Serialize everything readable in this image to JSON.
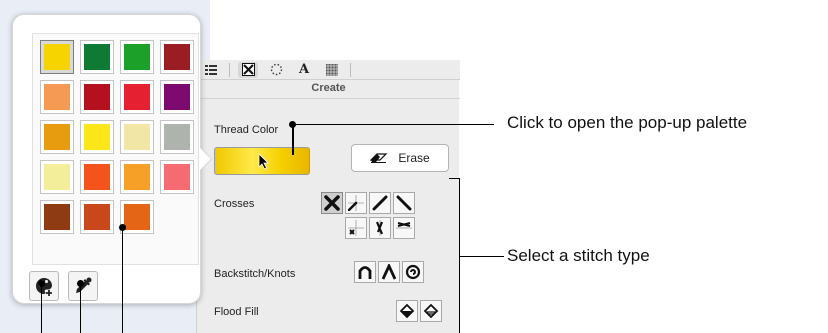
{
  "toolbar": {
    "icons": [
      "list-icon",
      "cross-stitch-tool-icon",
      "dotted-circle-icon",
      "text-tool-icon",
      "pattern-fill-icon"
    ],
    "text_glyph": "A"
  },
  "panel": {
    "title": "Create",
    "thread_color_label": "Thread Color",
    "thread_color": "#f5d200",
    "erase_label": "Erase",
    "crosses_label": "Crosses",
    "backstitch_label": "Backstitch/Knots",
    "flood_fill_label": "Flood Fill"
  },
  "palette": {
    "colors": [
      [
        "#f5d400",
        "#0f7a34",
        "#1ca02a",
        "#9b1d24"
      ],
      [
        "#f59a55",
        "#b5101d",
        "#e52030",
        "#7d0a6e"
      ],
      [
        "#e69c0e",
        "#fbe61a",
        "#f2e6a6",
        "#aeb4ad"
      ],
      [
        "#f3ee9a",
        "#f5531c",
        "#f6a028",
        "#f46c72"
      ],
      [
        "#8e3a12",
        "#c9481b",
        "#e56516"
      ]
    ],
    "selected_index": 0
  },
  "callouts": {
    "open_palette": "Click to open the pop-up palette",
    "stitch_type": "Select a stitch type"
  }
}
